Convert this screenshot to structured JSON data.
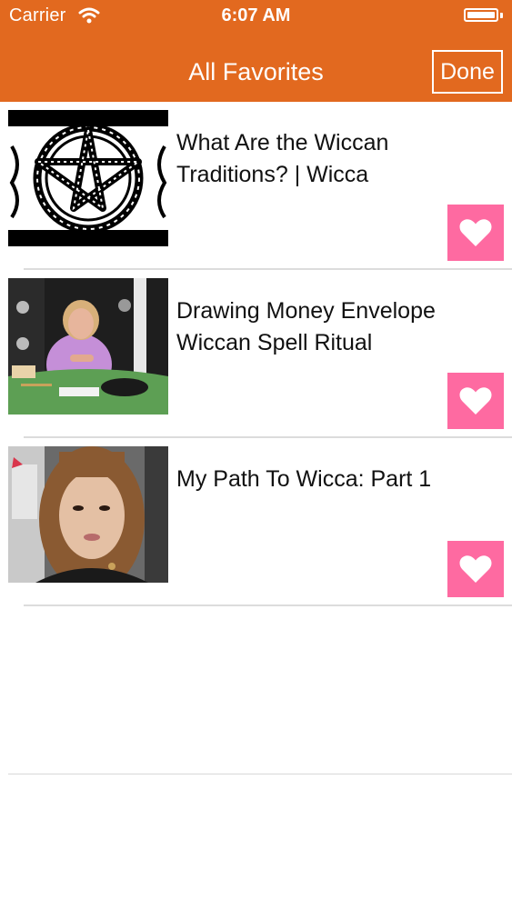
{
  "status_bar": {
    "carrier": "Carrier",
    "time": "6:07 AM"
  },
  "nav": {
    "title": "All Favorites",
    "done_label": "Done"
  },
  "favorites": [
    {
      "title": "What Are the Wiccan Traditions? | Wicca",
      "thumbnail": "pentacle"
    },
    {
      "title": "Drawing Money Envelope Wiccan Spell Ritual",
      "thumbnail": "woman-at-table"
    },
    {
      "title": "My Path To Wicca: Part 1",
      "thumbnail": "webcam-girl"
    }
  ],
  "icons": {
    "favorite": "heart-icon",
    "wifi": "wifi-icon",
    "battery": "battery-icon"
  },
  "colors": {
    "header": "#e2691f",
    "favorite_button": "#fe6aa1",
    "header_text": "#ffffff"
  }
}
